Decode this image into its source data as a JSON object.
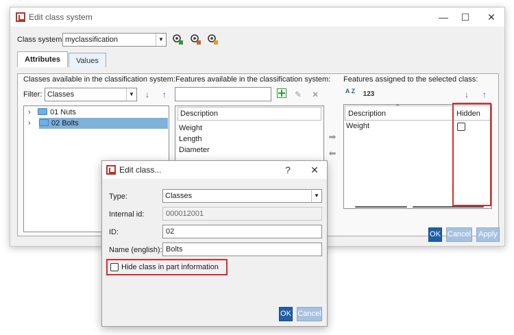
{
  "main_window": {
    "title": "Edit class system",
    "minimize": "—",
    "maximize": "☐",
    "close": "✕"
  },
  "class_system": {
    "label": "Class system:",
    "value": "myclassification"
  },
  "tabs": [
    {
      "label": "Attributes",
      "active": true
    },
    {
      "label": "Values",
      "active": false
    }
  ],
  "classes_section": {
    "heading": "Classes available in the classification system:",
    "filter_label": "Filter:",
    "filter_value": "Classes",
    "tree": [
      {
        "label": "01 Nuts",
        "selected": false
      },
      {
        "label": "02 Bolts",
        "selected": true
      }
    ]
  },
  "features_section": {
    "heading": "Features available in the classification system:",
    "search_value": "",
    "column_header": "Description",
    "items": [
      "Weight",
      "Length",
      "Diameter"
    ]
  },
  "assigned_section": {
    "heading": "Features assigned to the selected class:",
    "sort_az": "A Z",
    "sort_num": "123",
    "col_description": "Description",
    "col_hidden": "Hidden",
    "rows": [
      {
        "description": "Weight",
        "hidden": false
      }
    ]
  },
  "main_buttons": {
    "ok": "OK",
    "cancel": "Cancel",
    "apply": "Apply"
  },
  "dialog": {
    "title": "Edit class...",
    "help": "?",
    "close": "✕",
    "type_label": "Type:",
    "type_value": "Classes",
    "internal_id_label": "Internal id:",
    "internal_id_value": "000012001",
    "id_label": "ID:",
    "id_value": "02",
    "name_label": "Name (english):",
    "name_value": "Bolts",
    "hide_label": "Hide class in part information",
    "hide_checked": false,
    "ok": "OK",
    "cancel": "Cancel"
  }
}
